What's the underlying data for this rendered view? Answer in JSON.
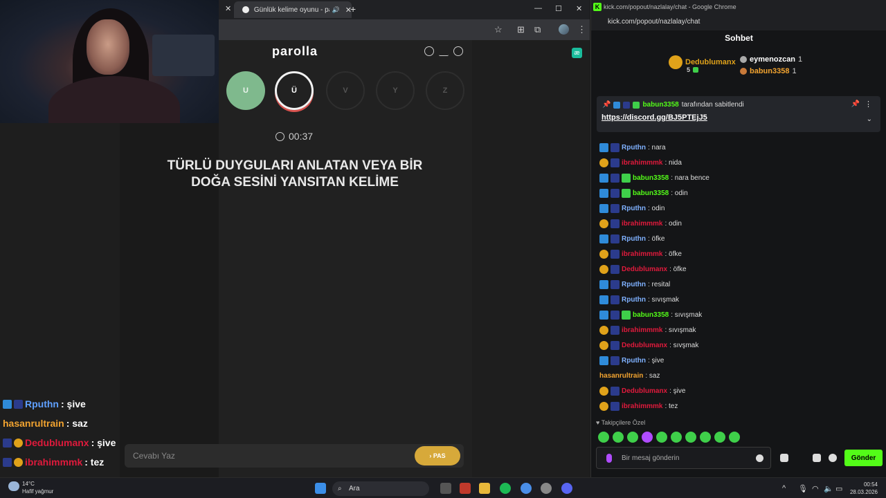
{
  "game_browser": {
    "tab_title": "Günlük kelime oyunu - parolla",
    "brand": "parolla",
    "letters": [
      "U",
      "Ü",
      "V",
      "Y",
      "Z"
    ],
    "timer": "00:37",
    "clue": "TÜRLÜ DUYGULARI ANLATAN VEYA BİR DOĞA SESİNİ YANSITAN KELİME",
    "answer_placeholder": "Cevabı Yaz",
    "pass_label": "PAS",
    "colors": {
      "done": "#7fb98d",
      "active_ring": "#d9534f",
      "pass": "#d7a93a"
    }
  },
  "overlay_chat": [
    {
      "user": "Rputhn",
      "text": ": şive",
      "color": "#5fa0ff"
    },
    {
      "user": "hasanrultrain",
      "text": ": saz",
      "color": "#f3a430"
    },
    {
      "user": "Dedublumanx",
      "text": ": şive",
      "color": "#e01a3c"
    },
    {
      "user": "ibrahimmmk",
      "text": ": tez",
      "color": "#e01a3c"
    }
  ],
  "chat_window": {
    "title": "kick.com/popout/nazlalay/chat - Google Chrome",
    "url": "kick.com/popout/nazlalay/chat",
    "heading": "Sohbet",
    "top_donors": [
      {
        "rank": "1",
        "name": "Dedublumanx",
        "count": "5"
      },
      {
        "name": "eymenozcan",
        "count": "1"
      },
      {
        "name": "babun3358",
        "count": "1"
      }
    ],
    "pinned_by": "babun3358",
    "pinned_suffix": "tarafından sabitlendi",
    "pinned_link": "https://discord.gg/BJ5PTEjJ5",
    "messages": [
      {
        "user": "Rputhn",
        "text": ": nara",
        "color": "#7fb1ff"
      },
      {
        "user": "ibrahimmmk",
        "text": ": nida",
        "color": "#e01a3c"
      },
      {
        "user": "babun3358",
        "text": ": nara bence",
        "color": "#53fc18"
      },
      {
        "user": "babun3358",
        "text": ": odin",
        "color": "#53fc18"
      },
      {
        "user": "Rputhn",
        "text": ": odin",
        "color": "#7fb1ff"
      },
      {
        "user": "ibrahimmmk",
        "text": ": odin",
        "color": "#e01a3c"
      },
      {
        "user": "Rputhn",
        "text": ": öfke",
        "color": "#7fb1ff"
      },
      {
        "user": "ibrahimmmk",
        "text": ": öfke",
        "color": "#e01a3c"
      },
      {
        "user": "Dedublumanx",
        "text": ": öfke",
        "color": "#e01a3c"
      },
      {
        "user": "Rputhn",
        "text": ": resital",
        "color": "#7fb1ff"
      },
      {
        "user": "Rputhn",
        "text": ": sıvışmak",
        "color": "#7fb1ff"
      },
      {
        "user": "babun3358",
        "text": ": sıvışmak",
        "color": "#53fc18"
      },
      {
        "user": "ibrahimmmk",
        "text": ": sıvışmak",
        "color": "#e01a3c"
      },
      {
        "user": "Dedublumanx",
        "text": ": sıvşmak",
        "color": "#e01a3c"
      },
      {
        "user": "Rputhn",
        "text": ": şive",
        "color": "#7fb1ff"
      },
      {
        "user": "hasanrultrain",
        "text": ": saz",
        "color": "#f3a430"
      },
      {
        "user": "Dedublumanx",
        "text": ": şive",
        "color": "#e01a3c"
      },
      {
        "user": "ibrahimmmk",
        "text": ": tez",
        "color": "#e01a3c"
      }
    ],
    "followers_label": "Takipçilere Özel",
    "input_placeholder": "Bir mesaj gönderin",
    "send_label": "Gönder"
  },
  "taskbar": {
    "temperature": "14°C",
    "weather": "Hafif yağmur",
    "search": "Ara",
    "time": "00:54",
    "date": "28.03.2026"
  }
}
